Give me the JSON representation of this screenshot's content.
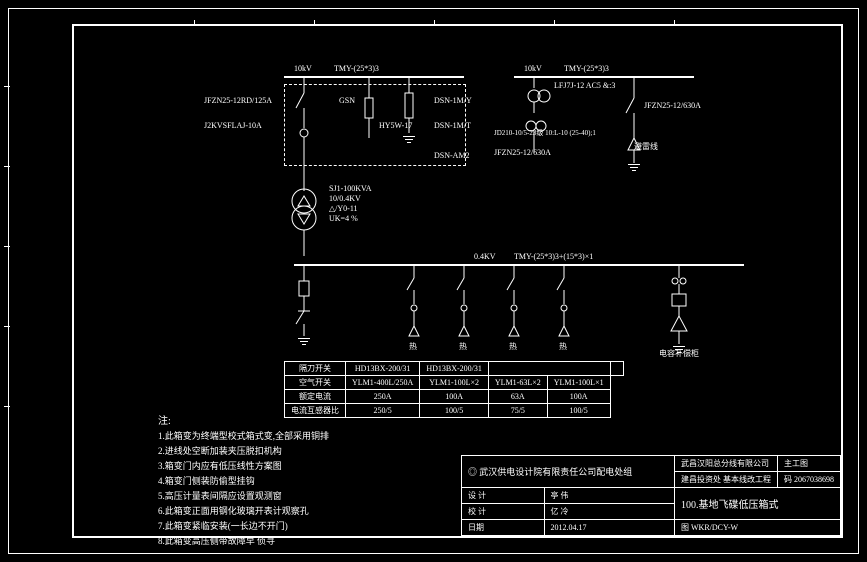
{
  "bus10kv_left": {
    "voltage": "10kV",
    "busbar": "TMY-(25*3)3"
  },
  "bus10kv_right": {
    "voltage": "10kV",
    "busbar": "TMY-(25*3)3"
  },
  "breaker1": "JFZN25-12RD/125A",
  "fuse1": "J2KVSFLAJ-10A",
  "gsn": "GSN",
  "arrester": "HY5W-17",
  "dsn1": "DSN-1M/Y",
  "dsn2": "DSN-1M/T",
  "dsn3": "DSN-AM2",
  "lfjj": "LFJ7J-12\nAC5 &:3",
  "jd": "JD210-10/5-23级\n10:L-10 (25-40);1",
  "breaker2": "JFZN25-12/630A",
  "breaker3": "JFZN25-12/630A",
  "bilei": "避雷线",
  "transformer": {
    "model": "SJ1-100KVA",
    "ratio": "10/0.4KV",
    "conn": "△/Y0-11",
    "uk": "UK=4 %"
  },
  "bus04kv": {
    "voltage": "0.4KV",
    "busbar": "TMY-(25*3)3+(15*3)×1"
  },
  "outlets": [
    "热",
    "热",
    "热",
    "热"
  ],
  "capacitor": "电容补偿柜",
  "table": {
    "rows": [
      {
        "label": "隔刀开关",
        "c1": "HD13BX-200/31",
        "c2": "HD13BX-200/31",
        "c3": "",
        "c4": ""
      },
      {
        "label": "空气开关",
        "c1": "YLM1-400L/250A",
        "c2": "YLM1-100L×2",
        "c3": "YLM1-63L×2",
        "c4": "YLM1-100L×1"
      },
      {
        "label": "额定电流",
        "c1": "250A",
        "c2": "100A",
        "c3": "63A",
        "c4": "100A"
      },
      {
        "label": "电流互感器比",
        "c1": "250/5",
        "c2": "100/5",
        "c3": "75/5",
        "c4": "100/5"
      }
    ]
  },
  "notes": {
    "title": "注:",
    "items": [
      "1.此箱变为终端型校式箱式变,全部采用铜排",
      "2.进线处空断加装夹压脱扣机构",
      "3.箱变门内应有低压线性方案图",
      "4.箱变门侧装防偷型挂钩",
      "5.高压计量表间隔应设置观测窗",
      "6.此箱变正面用钢化玻璃开表计观察孔",
      "7.此箱变紧临安装(一长边不开门)",
      "8.此箱变高压侧带故障早 侦寻"
    ]
  },
  "titleblock": {
    "company_left": "武汉供电设计院有限责任公司配电处组",
    "company_right": "武昌汉阳总分线有限公司",
    "subcompany": "建昌投资处 基本线改工程",
    "project": "100.基地飞碟低压箱式",
    "designed": "设 计",
    "designer": "亭 伟",
    "reviewed": "校 计",
    "reviewer": "亿 冷",
    "date_lbl": "日期",
    "date": "2012.04.17",
    "drawing_no": "图 WKR/DCY-W",
    "main": "主工图",
    "code": "码 2067038698"
  }
}
